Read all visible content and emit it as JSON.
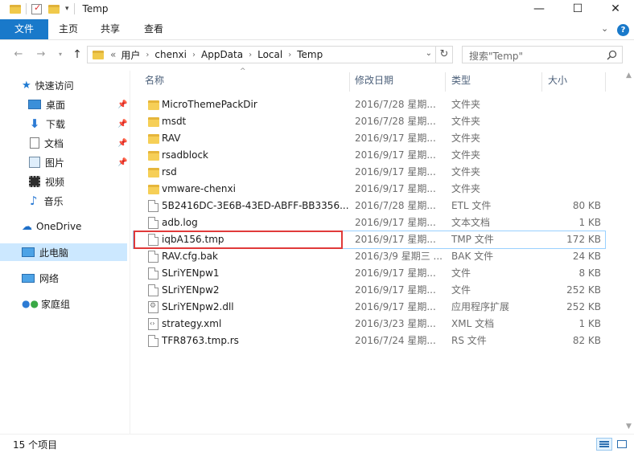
{
  "window": {
    "title": "Temp",
    "controls": {
      "minimize": "—",
      "maximize": "☐",
      "close": "✕"
    }
  },
  "ribbon": {
    "tabs": [
      {
        "label": "文件"
      },
      {
        "label": "主页"
      },
      {
        "label": "共享"
      },
      {
        "label": "查看"
      }
    ]
  },
  "address": {
    "overflow": "«",
    "crumbs": [
      "用户",
      "chenxi",
      "AppData",
      "Local",
      "Temp"
    ]
  },
  "search": {
    "placeholder": "搜索\"Temp\""
  },
  "nav": {
    "quick_access": "快速访问",
    "items": [
      {
        "label": "桌面",
        "icon": "desktop-icon",
        "pinned": true
      },
      {
        "label": "下载",
        "icon": "download-icon",
        "pinned": true
      },
      {
        "label": "文档",
        "icon": "document-icon",
        "pinned": true
      },
      {
        "label": "图片",
        "icon": "picture-icon",
        "pinned": true
      },
      {
        "label": "视频",
        "icon": "video-icon",
        "pinned": false
      },
      {
        "label": "音乐",
        "icon": "music-icon",
        "pinned": false
      }
    ],
    "onedrive": "OneDrive",
    "this_pc": "此电脑",
    "network": "网络",
    "homegroup": "家庭组"
  },
  "columns": {
    "name": "名称",
    "date": "修改日期",
    "type": "类型",
    "size": "大小"
  },
  "files": [
    {
      "name": "MicroThemePackDir",
      "date": "2016/7/28 星期...",
      "type": "文件夹",
      "size": "",
      "icon": "folder"
    },
    {
      "name": "msdt",
      "date": "2016/7/28 星期...",
      "type": "文件夹",
      "size": "",
      "icon": "folder"
    },
    {
      "name": "RAV",
      "date": "2016/9/17 星期...",
      "type": "文件夹",
      "size": "",
      "icon": "folder"
    },
    {
      "name": "rsadblock",
      "date": "2016/9/17 星期...",
      "type": "文件夹",
      "size": "",
      "icon": "folder"
    },
    {
      "name": "rsd",
      "date": "2016/9/17 星期...",
      "type": "文件夹",
      "size": "",
      "icon": "folder"
    },
    {
      "name": "vmware-chenxi",
      "date": "2016/9/17 星期...",
      "type": "文件夹",
      "size": "",
      "icon": "folder"
    },
    {
      "name": "5B2416DC-3E6B-43ED-ABFF-BB3356...",
      "date": "2016/7/28 星期...",
      "type": "ETL 文件",
      "size": "80 KB",
      "icon": "file"
    },
    {
      "name": "adb.log",
      "date": "2016/9/17 星期...",
      "type": "文本文档",
      "size": "1 KB",
      "icon": "file"
    },
    {
      "name": "iqbA156.tmp",
      "date": "2016/9/17 星期...",
      "type": "TMP 文件",
      "size": "172 KB",
      "icon": "file"
    },
    {
      "name": "RAV.cfg.bak",
      "date": "2016/3/9 星期三 ...",
      "type": "BAK 文件",
      "size": "24 KB",
      "icon": "file"
    },
    {
      "name": "SLriYENpw1",
      "date": "2016/9/17 星期...",
      "type": "文件",
      "size": "8 KB",
      "icon": "file"
    },
    {
      "name": "SLriYENpw2",
      "date": "2016/9/17 星期...",
      "type": "文件",
      "size": "252 KB",
      "icon": "file"
    },
    {
      "name": "SLriYENpw2.dll",
      "date": "2016/9/17 星期...",
      "type": "应用程序扩展",
      "size": "252 KB",
      "icon": "dll"
    },
    {
      "name": "strategy.xml",
      "date": "2016/3/23 星期...",
      "type": "XML 文档",
      "size": "1 KB",
      "icon": "xml"
    },
    {
      "name": "TFR8763.tmp.rs",
      "date": "2016/7/24 星期...",
      "type": "RS 文件",
      "size": "82 KB",
      "icon": "file"
    }
  ],
  "status": {
    "item_count": "15 个项目"
  }
}
